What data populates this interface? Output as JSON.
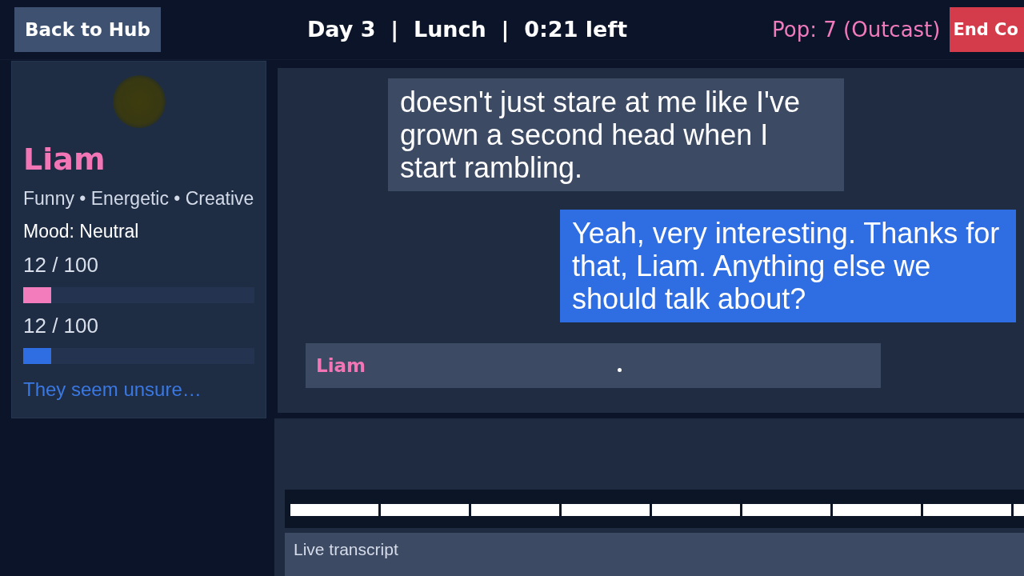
{
  "top_bar": {
    "back_button": "Back to Hub",
    "status": "Day 3  |  Lunch  |  0:21 left",
    "popularity": "Pop: 7 (Outcast)",
    "end_button": "End Co"
  },
  "character": {
    "name": "Liam",
    "traits": "Funny • Energetic • Creative",
    "mood": "Mood: Neutral",
    "meters": [
      {
        "reading": "12 / 100",
        "level": 0.12,
        "color": "#f27cbc"
      },
      {
        "reading": "12 / 100",
        "level": 0.12,
        "color": "#2f6de2"
      }
    ],
    "hint": "They seem unsure…"
  },
  "chat": {
    "messages": [
      {
        "kind": "npc",
        "text": "doesn't just stare at me like I've grown a second head when I start rambling."
      },
      {
        "kind": "player",
        "text": "Yeah, very interesting. Thanks for that, Liam. Anything else we should talk about?"
      },
      {
        "kind": "typing",
        "name": "Liam"
      }
    ]
  },
  "voice": {
    "transcript_label": "Live transcript"
  }
}
